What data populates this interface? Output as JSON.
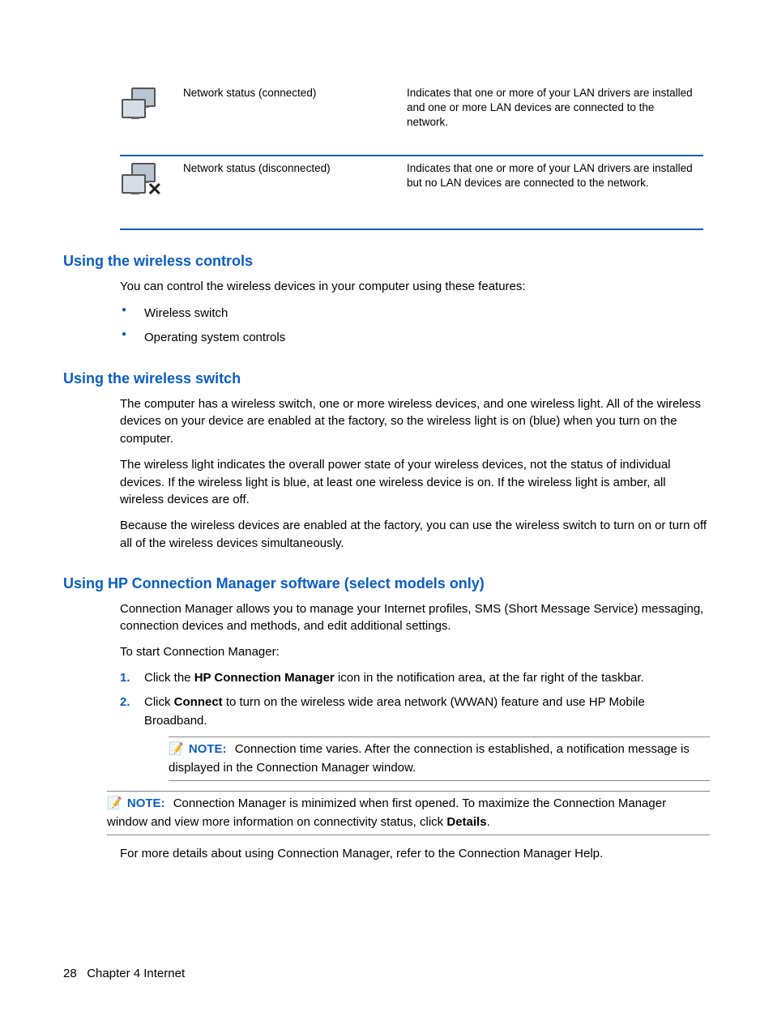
{
  "table": {
    "rows": [
      {
        "label": "Network status (connected)",
        "desc": "Indicates that one or more of your LAN drivers are installed and one or more LAN devices are connected to the network."
      },
      {
        "label": "Network status (disconnected)",
        "desc": "Indicates that one or more of your LAN drivers are installed but no LAN devices are connected to the network."
      }
    ]
  },
  "sections": {
    "controls": {
      "heading": "Using the wireless controls",
      "intro": "You can control the wireless devices in your computer using these features:",
      "bullets": [
        "Wireless switch",
        "Operating system controls"
      ]
    },
    "switch": {
      "heading": "Using the wireless switch",
      "p1": "The computer has a wireless switch, one or more wireless devices, and one wireless light. All of the wireless devices on your device are enabled at the factory, so the wireless light is on (blue) when you turn on the computer.",
      "p2": "The wireless light indicates the overall power state of your wireless devices, not the status of individual devices. If the wireless light is blue, at least one wireless device is on. If the wireless light is amber, all wireless devices are off.",
      "p3": "Because the wireless devices are enabled at the factory, you can use the wireless switch to turn on or turn off all of the wireless devices simultaneously."
    },
    "cm": {
      "heading": "Using HP Connection Manager software (select models only)",
      "p1": "Connection Manager allows you to manage your Internet profiles, SMS (Short Message Service) messaging, connection devices and methods, and edit additional settings.",
      "p2": "To start Connection Manager:",
      "step1_a": "Click the ",
      "step1_b": "HP Connection Manager",
      "step1_c": " icon in the notification area, at the far right of the taskbar.",
      "step2_a": "Click ",
      "step2_b": "Connect",
      "step2_c": " to turn on the wireless wide area network (WWAN) feature and use HP Mobile Broadband.",
      "note1_label": "NOTE:",
      "note1_text": "Connection time varies. After the connection is established, a notification message is displayed in the Connection Manager window.",
      "note2_label": "NOTE:",
      "note2_a": "Connection Manager is minimized when first opened. To maximize the Connection Manager window and view more information on connectivity status, click ",
      "note2_b": "Details",
      "note2_c": ".",
      "p3": "For more details about using Connection Manager, refer to the Connection Manager Help."
    }
  },
  "footer": {
    "page_num": "28",
    "chapter": "Chapter 4   Internet"
  }
}
